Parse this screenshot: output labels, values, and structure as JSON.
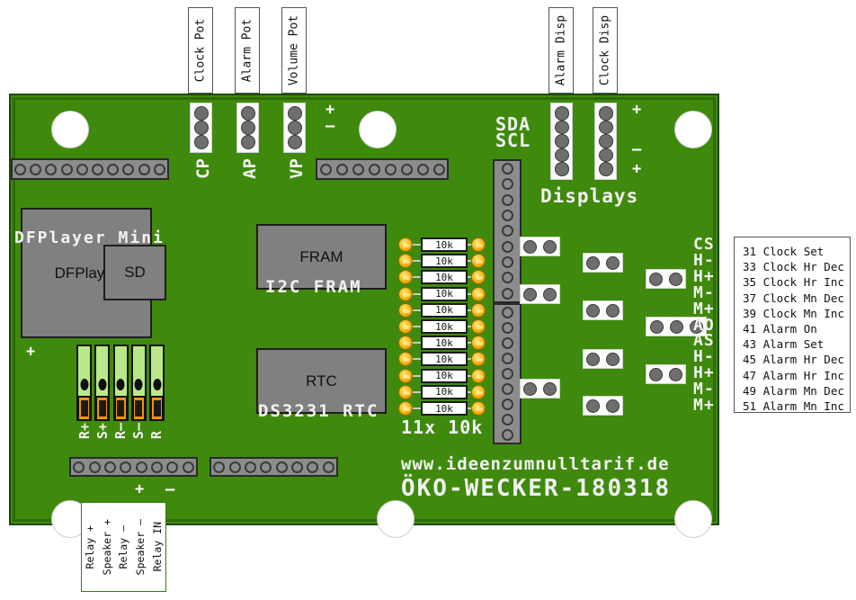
{
  "board": {
    "silkscreen_color": "#f2f2f2",
    "pcb_color": "#3f8a0c",
    "website": "www.ideenzumnulltarif.de",
    "project_name": "ÖKO-WECKER-180318",
    "displays_label": "Displays",
    "i2c_labels": {
      "sda": "SDA",
      "scl": "SCL"
    },
    "resistor_caption": "11x 10k",
    "resistor_value": "10k",
    "resistor_count": 11,
    "hidden_silk": {
      "dfplayer": "DFPlayer Mini",
      "fram": "I2C FRAM",
      "rtc": "DS3231 RTC"
    }
  },
  "modules": [
    {
      "name": "DFPlayer",
      "label": "DFPlayer"
    },
    {
      "name": "SD",
      "label": "SD"
    },
    {
      "name": "FRAM",
      "label": "FRAM"
    },
    {
      "name": "RTC",
      "label": "RTC"
    }
  ],
  "top_callouts": [
    {
      "name": "clock-pot",
      "label": "Clock Pot",
      "silk": "CP"
    },
    {
      "name": "alarm-pot",
      "label": "Alarm Pot",
      "silk": "AP"
    },
    {
      "name": "volume-pot",
      "label": "Volume Pot",
      "silk": "VP"
    },
    {
      "name": "alarm-display",
      "label": "Alarm Disp",
      "silk": ""
    },
    {
      "name": "clock-display",
      "label": "Clock Disp",
      "silk": ""
    }
  ],
  "bottom_callout": {
    "labels": [
      "Relay +",
      "Speaker +",
      "Relay –",
      "Speaker –",
      "Relay IN"
    ]
  },
  "terminal_silk": [
    "R+",
    "S+",
    "R–",
    "S–",
    "R"
  ],
  "button_abbrev": [
    "CS",
    "H-",
    "H+",
    "M-",
    "M+",
    "AO",
    "AS",
    "H-",
    "H+",
    "M-",
    "M+"
  ],
  "legend_right": {
    "rows": [
      "31 Clock Set",
      "33 Clock Hr Dec",
      "35 Clock Hr Inc",
      "37 Clock Mn Dec",
      "39 Clock Mn Inc",
      "41 Alarm On",
      "43 Alarm Set",
      "45 Alarm Hr Dec",
      "47 Alarm Hr Inc",
      "49 Alarm Mn Dec",
      "51 Alarm Mn Inc"
    ]
  },
  "polarity_marks": {
    "top_plus": "+",
    "top_minus": "–",
    "disp_plus_top": "+",
    "disp_minus": "–",
    "disp_plus_bottom": "+",
    "term_plus": "+",
    "bottom_plus": "+",
    "bottom_minus": "–"
  }
}
